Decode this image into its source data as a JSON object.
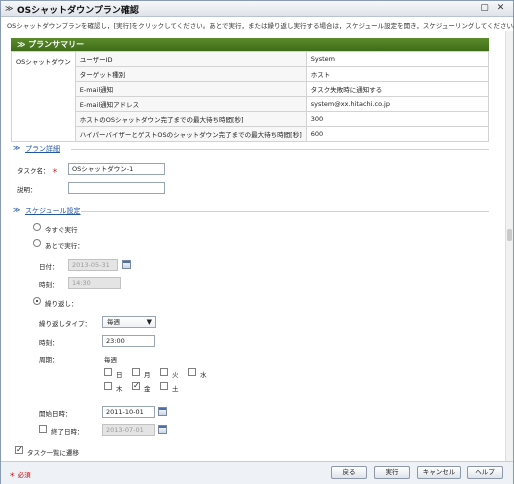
{
  "title": "OSシャットダウンプラン確認",
  "description": "OSシャットダウンプランを確認し，[実行]をクリックしてください。あとで実行，または繰り返し実行する場合は，スケジュール設定を開き，スケジューリングしてください。",
  "summary": {
    "header": "プランサマリー",
    "row_label": "OSシャットダウン",
    "rows": [
      {
        "key": "ユーザーID",
        "value": "System"
      },
      {
        "key": "ターゲット種別",
        "value": "ホスト"
      },
      {
        "key": "E-mail通知",
        "value": "タスク失敗時に通知する"
      },
      {
        "key": "E-mail通知アドレス",
        "value": "system@xx.hitachi.co.jp"
      },
      {
        "key": "ホストのOSシャットダウン完了までの最大待ち時間[秒]",
        "value": "300"
      },
      {
        "key": "ハイパーバイザーとゲストOSのシャットダウン完了までの最大待ち時間[秒]",
        "value": "600"
      }
    ]
  },
  "plan_detail": {
    "link": "プラン詳細",
    "task_name_label": "タスク名：",
    "required_mark": "＊",
    "task_name_value": "OSシャットダウン-1",
    "description_label": "説明：",
    "description_value": ""
  },
  "schedule": {
    "link": "スケジュール設定",
    "run_now": "今すぐ実行",
    "run_later": "あとで実行：",
    "date_label": "日付：",
    "date_value": "2013-05-31",
    "time_label": "時刻：",
    "time_value": "14:30",
    "repeat": "繰り返し：",
    "repeat_type_label": "繰り返しタイプ：",
    "repeat_type_value": "毎週",
    "repeat_time_label": "時刻：",
    "repeat_time_value": "23:00",
    "period_label": "周期：",
    "period_value": "毎週",
    "days": [
      {
        "label": "日",
        "checked": false
      },
      {
        "label": "月",
        "checked": false
      },
      {
        "label": "火",
        "checked": false
      },
      {
        "label": "水",
        "checked": false
      },
      {
        "label": "木",
        "checked": false
      },
      {
        "label": "金",
        "checked": true
      },
      {
        "label": "土",
        "checked": false
      }
    ],
    "start_label": "開始日時：",
    "start_value": "2011-10-01",
    "end_label": "終了日時：",
    "end_value": "2013-07-01"
  },
  "task_list_toggle": "タスク一覧に遷移",
  "footer": {
    "required_note": "必須",
    "back": "戻る",
    "run": "実行",
    "cancel": "キャンセル",
    "help": "ヘルプ"
  }
}
